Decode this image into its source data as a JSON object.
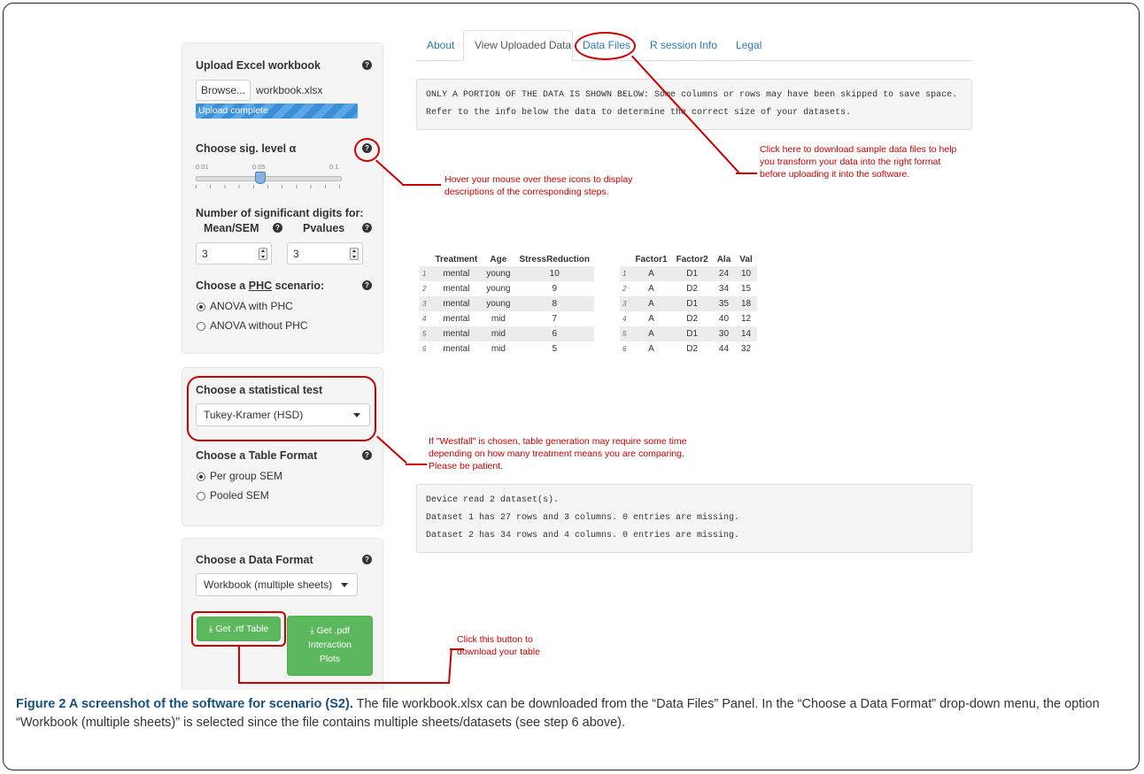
{
  "tabs": [
    "About",
    "View Uploaded Data",
    "Data Files",
    "R session Info",
    "Legal"
  ],
  "upload": {
    "label": "Upload Excel workbook",
    "browse": "Browse...",
    "filename": "workbook.xlsx",
    "status": "Upload complete"
  },
  "siglevel": {
    "label": "Choose sig. level α",
    "ticks": [
      "0.01",
      "0.05",
      "0.1"
    ],
    "value": 0.05
  },
  "digits": {
    "label": "Number of significant digits for:",
    "mean_label": "Mean/SEM",
    "pvalue_label": "Pvalues",
    "mean_value": "3",
    "pvalue_value": "3"
  },
  "phc": {
    "label": "Choose a PHC scenario:",
    "options": [
      "ANOVA with PHC",
      "ANOVA without PHC"
    ],
    "selected": 0
  },
  "test": {
    "label": "Choose a statistical test",
    "value": "Tukey-Kramer (HSD)"
  },
  "tableformat": {
    "label": "Choose a Table Format",
    "options": [
      "Per group SEM",
      "Pooled SEM"
    ],
    "selected": 0
  },
  "dataformat": {
    "label": "Choose a Data Format",
    "value": "Workbook (multiple sheets)"
  },
  "buttons": {
    "rtf": "Get .rtf Table",
    "pdf_line1": "Get .pdf",
    "pdf_line2": "Interaction",
    "pdf_line3": "Plots"
  },
  "notice": {
    "line1": "ONLY A PORTION OF THE DATA IS SHOWN BELOW: Some columns or rows may have been skipped to save space.",
    "line2": "Refer to the info below the data to determine the correct size of your datasets."
  },
  "table1": {
    "headers": [
      "",
      "Treatment",
      "Age",
      "StressReduction"
    ],
    "rows": [
      [
        "1",
        "mental",
        "young",
        "10"
      ],
      [
        "2",
        "mental",
        "young",
        "9"
      ],
      [
        "3",
        "mental",
        "young",
        "8"
      ],
      [
        "4",
        "mental",
        "mid",
        "7"
      ],
      [
        "5",
        "mental",
        "mid",
        "6"
      ],
      [
        "6",
        "mental",
        "mid",
        "5"
      ]
    ]
  },
  "table2": {
    "headers": [
      "",
      "Factor1",
      "Factor2",
      "Ala",
      "Val"
    ],
    "rows": [
      [
        "1",
        "A",
        "D1",
        "24",
        "10"
      ],
      [
        "2",
        "A",
        "D2",
        "34",
        "15"
      ],
      [
        "3",
        "A",
        "D1",
        "35",
        "18"
      ],
      [
        "4",
        "A",
        "D2",
        "40",
        "12"
      ],
      [
        "5",
        "A",
        "D1",
        "30",
        "14"
      ],
      [
        "6",
        "A",
        "D2",
        "44",
        "32"
      ]
    ]
  },
  "info": {
    "line1": "Device read  2 dataset(s).",
    "line2": "Dataset 1 has 27 rows and 3 columns. 0 entries are missing.",
    "line3": "Dataset 2 has 34 rows and 4 columns. 0 entries are missing."
  },
  "annotations": {
    "datafiles_1": "Click here to download sample data files to help",
    "datafiles_2": "you transform your data into the right format",
    "datafiles_3": "before uploading it into the software.",
    "hover_1": "Hover your mouse over these icons to display",
    "hover_2": "descriptions of the corresponding steps.",
    "westfall_1": "If \"Westfall\" is chosen, table generation may require some time",
    "westfall_2": "depending on how many treatment means you are comparing.",
    "westfall_3": "Please be patient.",
    "download_1": "Click this button to",
    "download_2": "download your table"
  },
  "caption": {
    "bold": "Figure 2 A screenshot of the software for scenario (S2).",
    "text": " The file workbook.xlsx can be downloaded from the “Data Files” Panel. In the “Choose a Data Format” drop-down menu, the option “Workbook (multiple sheets)” is selected since the file contains multiple sheets/datasets (see step 6 above)."
  },
  "colors": {
    "annotation_red": "#c00000",
    "link_blue": "#2a7ab8",
    "progress_blue": "#3a8fd6",
    "button_green": "#5cb85c",
    "caption_blue": "#1a4f82"
  }
}
